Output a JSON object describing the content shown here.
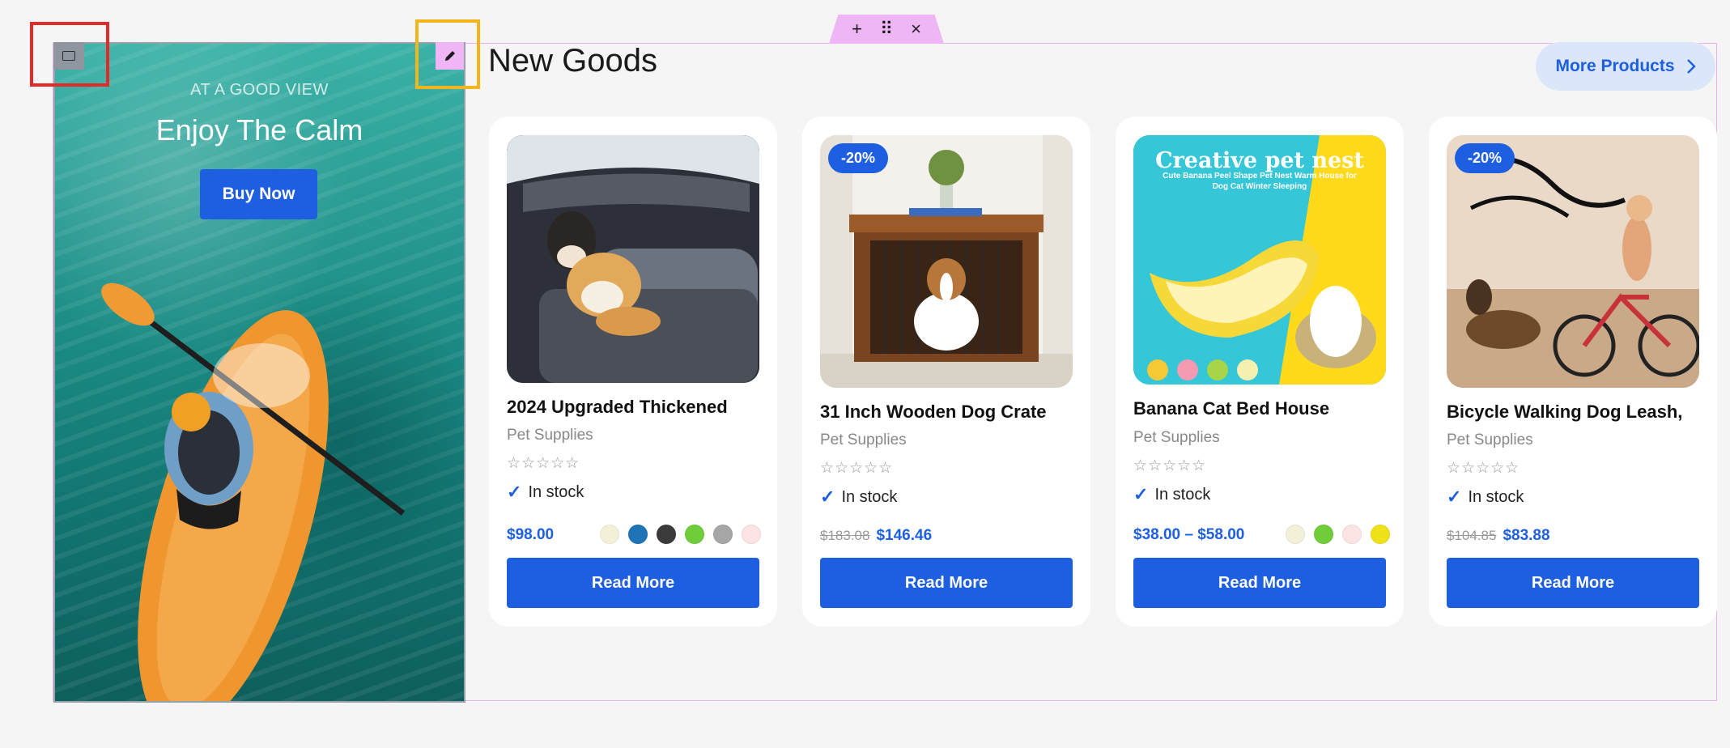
{
  "editor": {
    "toolbar_add": "+",
    "toolbar_drag": "⠿",
    "toolbar_close": "×"
  },
  "hero": {
    "subtitle": "AT A GOOD VIEW",
    "title": "Enjoy The Calm",
    "button": "Buy Now"
  },
  "section": {
    "title": "New Goods",
    "more_button": "More Products"
  },
  "products": [
    {
      "title": "2024 Upgraded Thickened",
      "category": "Pet Supplies",
      "rating_stars": "☆☆☆☆☆",
      "stock": "In stock",
      "price": "$98.00",
      "old_price": "",
      "badge": "",
      "button": "Read More",
      "swatches": [
        "#f2f1d8",
        "#1f73b7",
        "#3b3b3b",
        "#70cd3a",
        "#a6a6a6",
        "#fde4e4"
      ]
    },
    {
      "title": "31 Inch Wooden Dog Crate",
      "category": "Pet Supplies",
      "rating_stars": "☆☆☆☆☆",
      "stock": "In stock",
      "price": "$146.46",
      "old_price": "$183.08",
      "badge": "-20%",
      "button": "Read More",
      "swatches": []
    },
    {
      "title": "Banana Cat Bed House",
      "category": "Pet Supplies",
      "rating_stars": "☆☆☆☆☆",
      "stock": "In stock",
      "price": "$38.00 – $58.00",
      "old_price": "",
      "badge": "",
      "button": "Read More",
      "image_text_title": "Creative pet nest",
      "image_text_sub": "Cute Banana Peel Shape Pet Nest Warm House for Dog Cat Winter Sleeping",
      "swatches": [
        "#f2f1d8",
        "#70cd3a",
        "#fde4e4",
        "#f0e21a"
      ]
    },
    {
      "title": "Bicycle Walking Dog Leash,",
      "category": "Pet Supplies",
      "rating_stars": "☆☆☆☆☆",
      "stock": "In stock",
      "price": "$83.88",
      "old_price": "$104.85",
      "badge": "-20%",
      "button": "Read More",
      "swatches": []
    }
  ],
  "colors": {
    "accent": "#1d5fe0",
    "more_bg": "#dbe6fb",
    "editor_pink": "#efb6f6"
  }
}
